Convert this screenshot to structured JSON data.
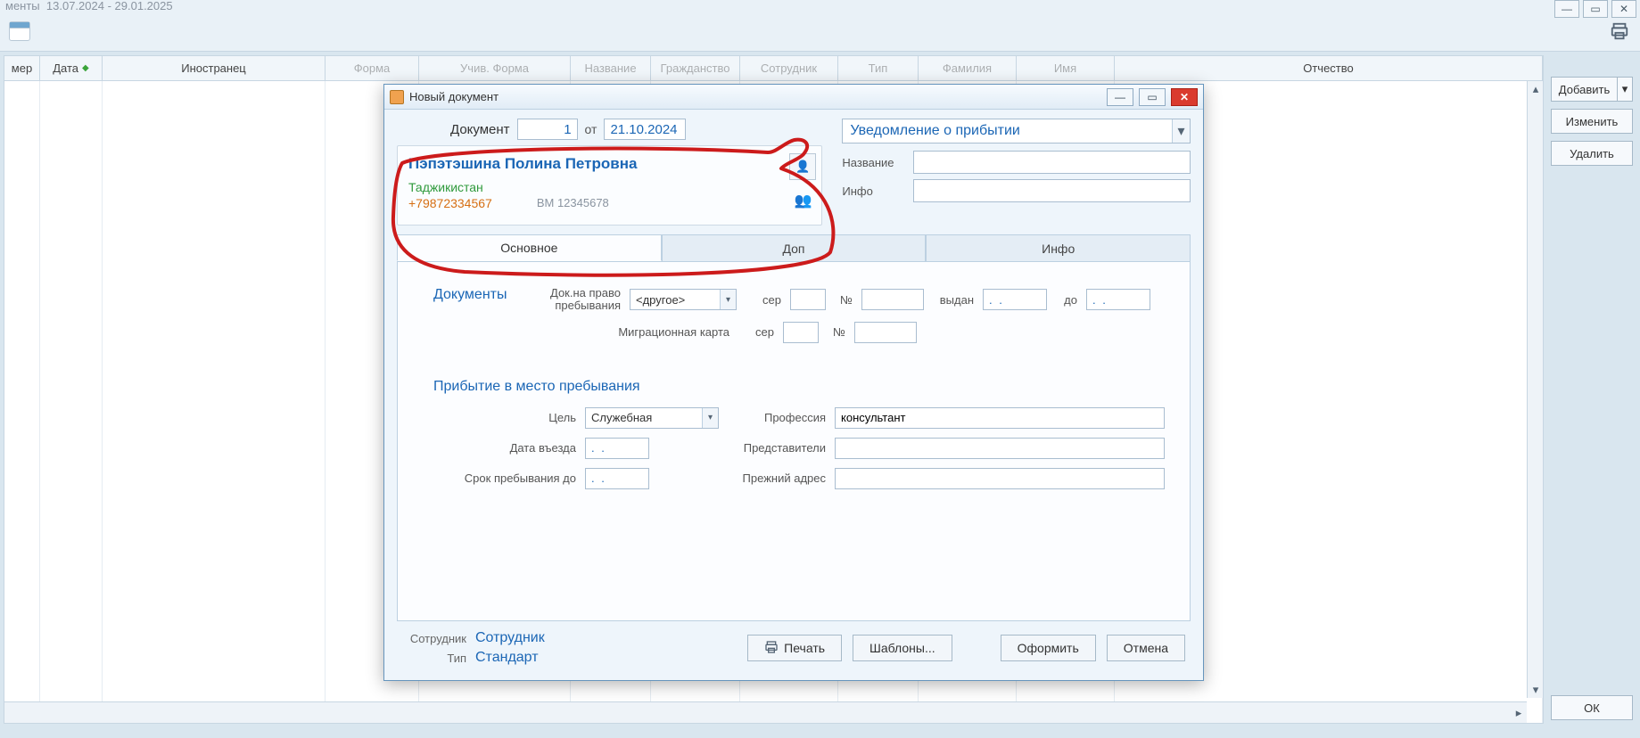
{
  "app": {
    "title_fragment": "менты",
    "date_from": "13.07.2024",
    "date_to": "29.01.2025"
  },
  "grid": {
    "columns": [
      "мер",
      "Дата",
      "Иностранец",
      "Форма",
      "Учив. Форма",
      "Название",
      "Гражданство",
      "Сотрудник",
      "Тип",
      "Фамилия",
      "Имя",
      "Отчество"
    ],
    "sort_col_index": 1
  },
  "side": {
    "add": "Добавить",
    "edit": "Изменить",
    "del": "Удалить",
    "ok": "ОК"
  },
  "dialog": {
    "title": "Новый документ",
    "doc": {
      "label": "Документ",
      "number": "1",
      "from": "от",
      "date": "21.10.2024"
    },
    "person": {
      "name": "Пэпэтэшина Полина Петровна",
      "country": "Таджикистан",
      "phone": "+79872334567",
      "docnum": "BM 12345678"
    },
    "type_select": "Уведомление о прибытии",
    "name_label": "Название",
    "info_label": "Инфо",
    "name_value": "",
    "info_value": "",
    "tabs": [
      "Основное",
      "Доп",
      "Инфо"
    ],
    "sections": {
      "docs": {
        "title": "Документы",
        "right_doc_label": "Док.на право пребывания",
        "right_doc_value": "<другое>",
        "ser": "сер",
        "no": "№",
        "issued": "выдан",
        "to": "до",
        "date_mask": ". .",
        "mig_label": "Миграционная карта"
      },
      "arrival": {
        "title": "Прибытие в место пребывания",
        "goal_label": "Цель",
        "goal_value": "Служебная",
        "prof_label": "Профессия",
        "prof_value": "консультант",
        "entry_label": "Дата въезда",
        "stay_label": "Срок пребывания до",
        "reps_label": "Представители",
        "prev_addr_label": "Прежний адрес"
      }
    },
    "footer": {
      "sotr_label": "Сотрудник",
      "sotr_value": "Сотрудник",
      "type_label": "Тип",
      "type_value": "Стандарт",
      "print": "Печать",
      "templates": "Шаблоны...",
      "issue": "Оформить",
      "cancel": "Отмена"
    }
  }
}
